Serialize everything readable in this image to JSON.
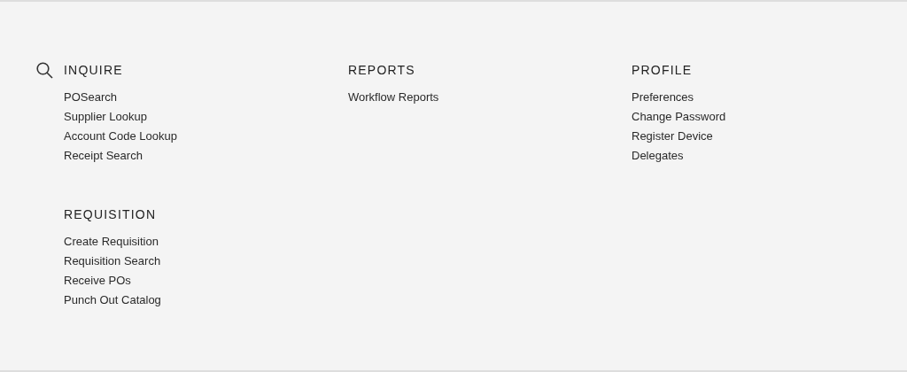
{
  "columns": [
    {
      "sections": [
        {
          "title": "INQUIRE",
          "icon": true,
          "links": [
            "POSearch",
            "Supplier Lookup",
            "Account Code Lookup",
            "Receipt Search"
          ]
        },
        {
          "title": "REQUISITION",
          "icon": false,
          "links": [
            "Create Requisition",
            "Requisition Search",
            "Receive POs",
            "Punch Out Catalog"
          ]
        }
      ]
    },
    {
      "sections": [
        {
          "title": "REPORTS",
          "icon": false,
          "links": [
            "Workflow Reports"
          ]
        }
      ]
    },
    {
      "sections": [
        {
          "title": "PROFILE",
          "icon": false,
          "links": [
            "Preferences",
            "Change Password",
            "Register Device",
            "Delegates"
          ]
        }
      ]
    }
  ]
}
